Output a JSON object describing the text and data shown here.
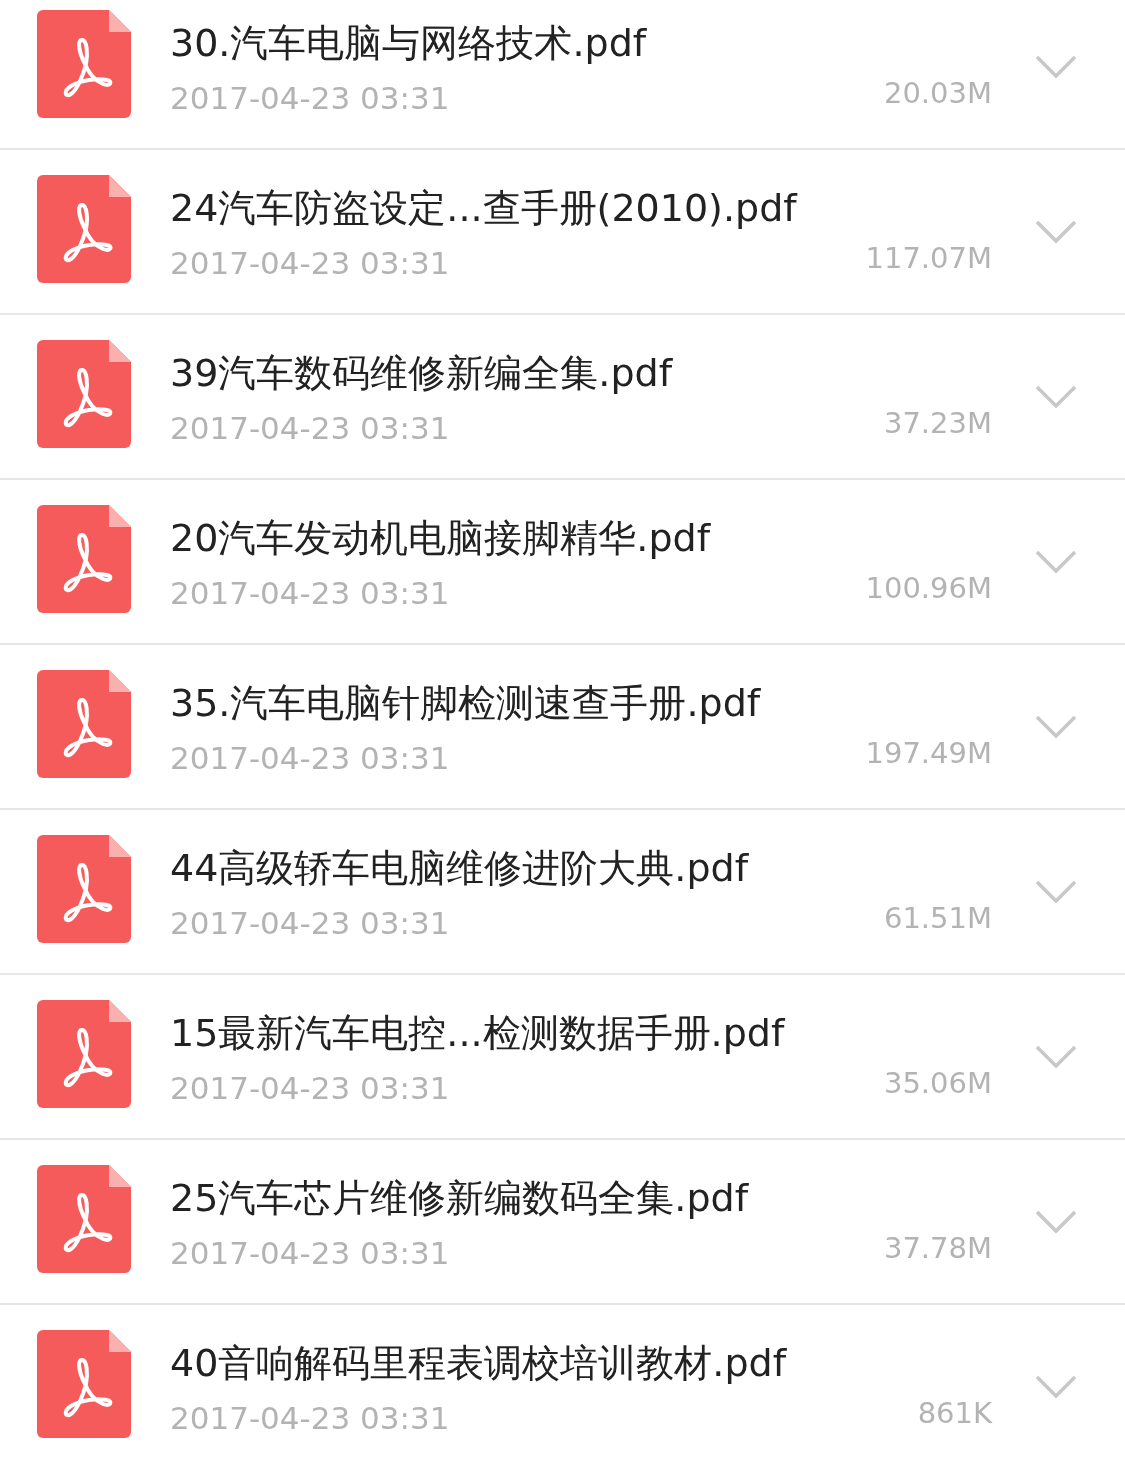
{
  "files": [
    {
      "name": "30.汽车电脑与网络技术.pdf",
      "date": "2017-04-23 03:31",
      "size": "20.03M"
    },
    {
      "name": "24汽车防盗设定...查手册(2010).pdf",
      "date": "2017-04-23 03:31",
      "size": "117.07M"
    },
    {
      "name": "39汽车数码维修新编全集.pdf",
      "date": "2017-04-23 03:31",
      "size": "37.23M"
    },
    {
      "name": "20汽车发动机电脑接脚精华.pdf",
      "date": "2017-04-23 03:31",
      "size": "100.96M"
    },
    {
      "name": "35.汽车电脑针脚检测速查手册.pdf",
      "date": "2017-04-23 03:31",
      "size": "197.49M"
    },
    {
      "name": "44高级轿车电脑维修进阶大典.pdf",
      "date": "2017-04-23 03:31",
      "size": "61.51M"
    },
    {
      "name": "15最新汽车电控...检测数据手册.pdf",
      "date": "2017-04-23 03:31",
      "size": "35.06M"
    },
    {
      "name": "25汽车芯片维修新编数码全集.pdf",
      "date": "2017-04-23 03:31",
      "size": "37.78M"
    },
    {
      "name": "40音响解码里程表调校培训教材.pdf",
      "date": "2017-04-23 03:31",
      "size": "861K"
    }
  ]
}
